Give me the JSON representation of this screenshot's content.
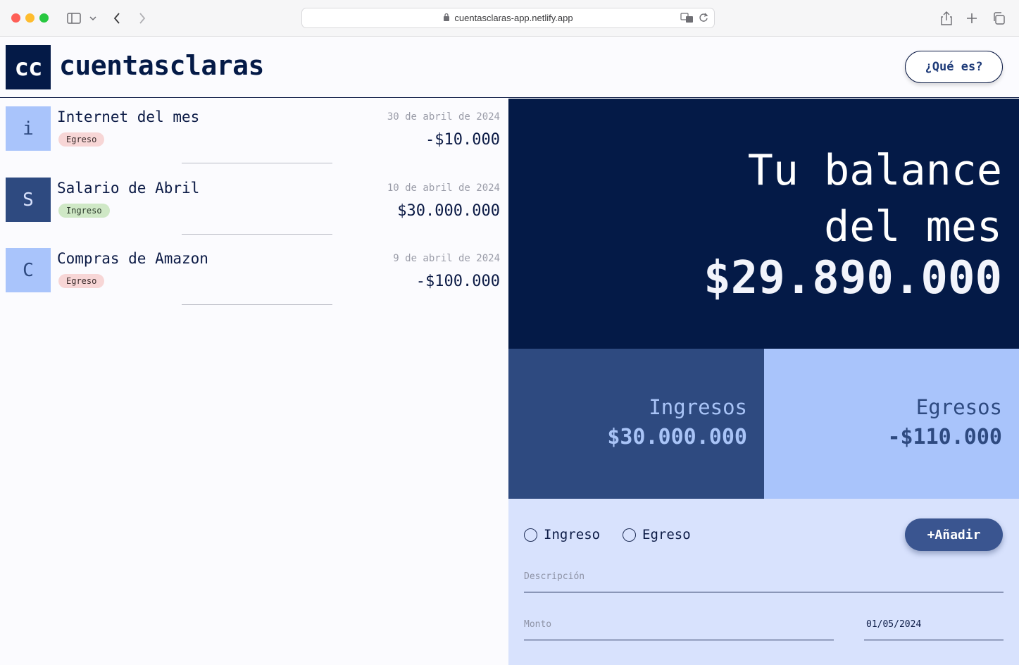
{
  "browser": {
    "url": "cuentasclaras-app.netlify.app"
  },
  "header": {
    "logo_initials": "cc",
    "app_name": "cuentasclaras",
    "what_button": "¿Qué es?"
  },
  "transactions": [
    {
      "initial": "i",
      "description": "Internet del mes",
      "type": "Egreso",
      "date": "30 de abril de 2024",
      "amount": "-$10.000"
    },
    {
      "initial": "S",
      "description": "Salario de Abril",
      "type": "Ingreso",
      "date": "10 de abril de 2024",
      "amount": "$30.000.000"
    },
    {
      "initial": "C",
      "description": "Compras de Amazon",
      "type": "Egreso",
      "date": "9 de abril de 2024",
      "amount": "-$100.000"
    }
  ],
  "balance": {
    "title_line1": "Tu balance",
    "title_line2": "del mes",
    "amount": "$29.890.000"
  },
  "summary": {
    "income_label": "Ingresos",
    "income_value": "$30.000.000",
    "expense_label": "Egresos",
    "expense_value": "-$110.000"
  },
  "form": {
    "radio_income": "Ingreso",
    "radio_expense": "Egreso",
    "add_button": "+Añadir",
    "description_placeholder": "Descripción",
    "amount_placeholder": "Monto",
    "date_value": "01/05/2024"
  },
  "colors": {
    "navy": "#041a47",
    "mid_blue": "#2e4a80",
    "light_blue": "#a9c4fb",
    "form_bg": "#d8e2fd",
    "egreso_badge": "#f7d6d6",
    "ingreso_badge": "#cfe8c6"
  }
}
